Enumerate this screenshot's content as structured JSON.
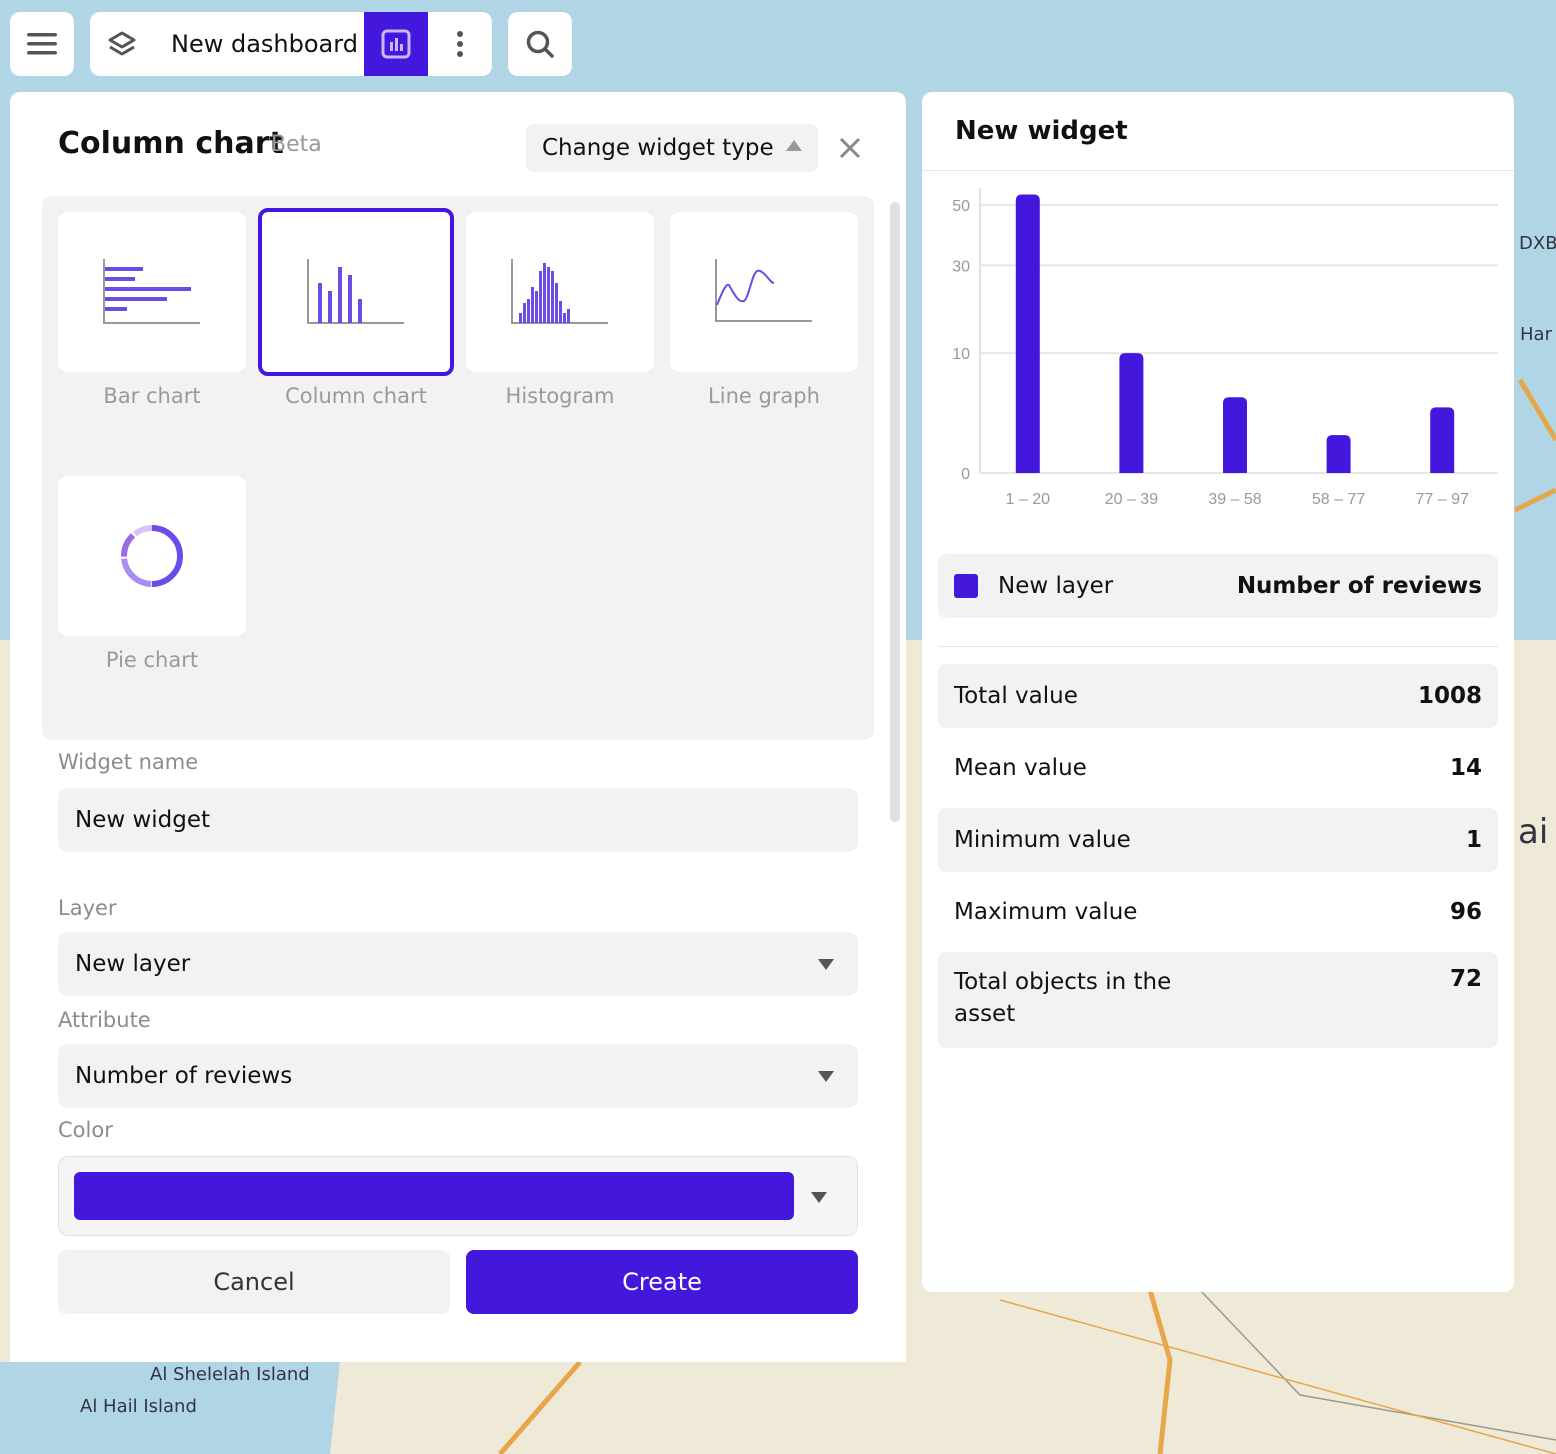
{
  "header": {
    "dashboard_title": "New dashboard",
    "icons": [
      "menu-icon",
      "layers-icon",
      "dashboard-chart-icon",
      "more-vertical-icon",
      "search-icon"
    ]
  },
  "map": {
    "labels": [
      "Al Hail Island",
      "Al Shelelah Island",
      "DXB",
      "Har",
      "ai"
    ]
  },
  "editor": {
    "title": "Column chart",
    "badge": "Beta",
    "change_type_label": "Change widget type",
    "widget_types": [
      {
        "label": "Bar chart"
      },
      {
        "label": "Column chart",
        "selected": true
      },
      {
        "label": "Histogram"
      },
      {
        "label": "Line graph"
      },
      {
        "label": "Pie chart"
      }
    ],
    "widget_name_label": "Widget name",
    "widget_name_value": "New widget",
    "layer_label": "Layer",
    "layer_value": "New layer",
    "attribute_label": "Attribute",
    "attribute_value": "Number of reviews",
    "color_label": "Color",
    "color_value": "#4318dc",
    "cancel_label": "Cancel",
    "create_label": "Create"
  },
  "widget": {
    "title": "New widget",
    "legend": {
      "layer": "New layer",
      "attribute": "Number of reviews",
      "color": "#4318dc"
    },
    "stats": [
      {
        "label": "Total value",
        "value": "1008"
      },
      {
        "label": "Mean value",
        "value": "14"
      },
      {
        "label": "Minimum value",
        "value": "1"
      },
      {
        "label": "Maximum value",
        "value": "96"
      },
      {
        "label": "Total objects in the asset",
        "value": "72"
      }
    ]
  },
  "chart_data": {
    "type": "bar",
    "scale": "sqrt",
    "grid": true,
    "categories": [
      "1 – 20",
      "20 – 39",
      "39 – 58",
      "58 – 77",
      "77 – 97"
    ],
    "values": [
      54,
      10,
      4,
      1,
      3
    ],
    "yticks": [
      0,
      10,
      30,
      50
    ],
    "ylim": [
      0,
      54
    ],
    "color": "#4318dc"
  }
}
